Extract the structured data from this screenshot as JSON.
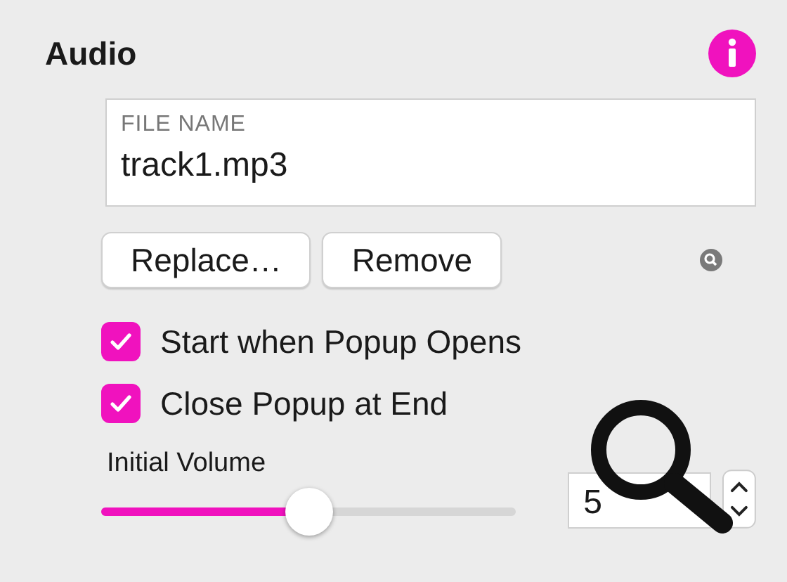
{
  "section": {
    "title": "Audio"
  },
  "file": {
    "label": "FILE NAME",
    "value": "track1.mp3"
  },
  "buttons": [
    "Replace…",
    "Remove"
  ],
  "options": [
    {
      "label": "Start when Popup Opens",
      "checked": true
    },
    {
      "label": "Close Popup at End",
      "checked": true
    }
  ],
  "volume": {
    "label": "Initial Volume",
    "level": 0.5,
    "value": "5"
  }
}
